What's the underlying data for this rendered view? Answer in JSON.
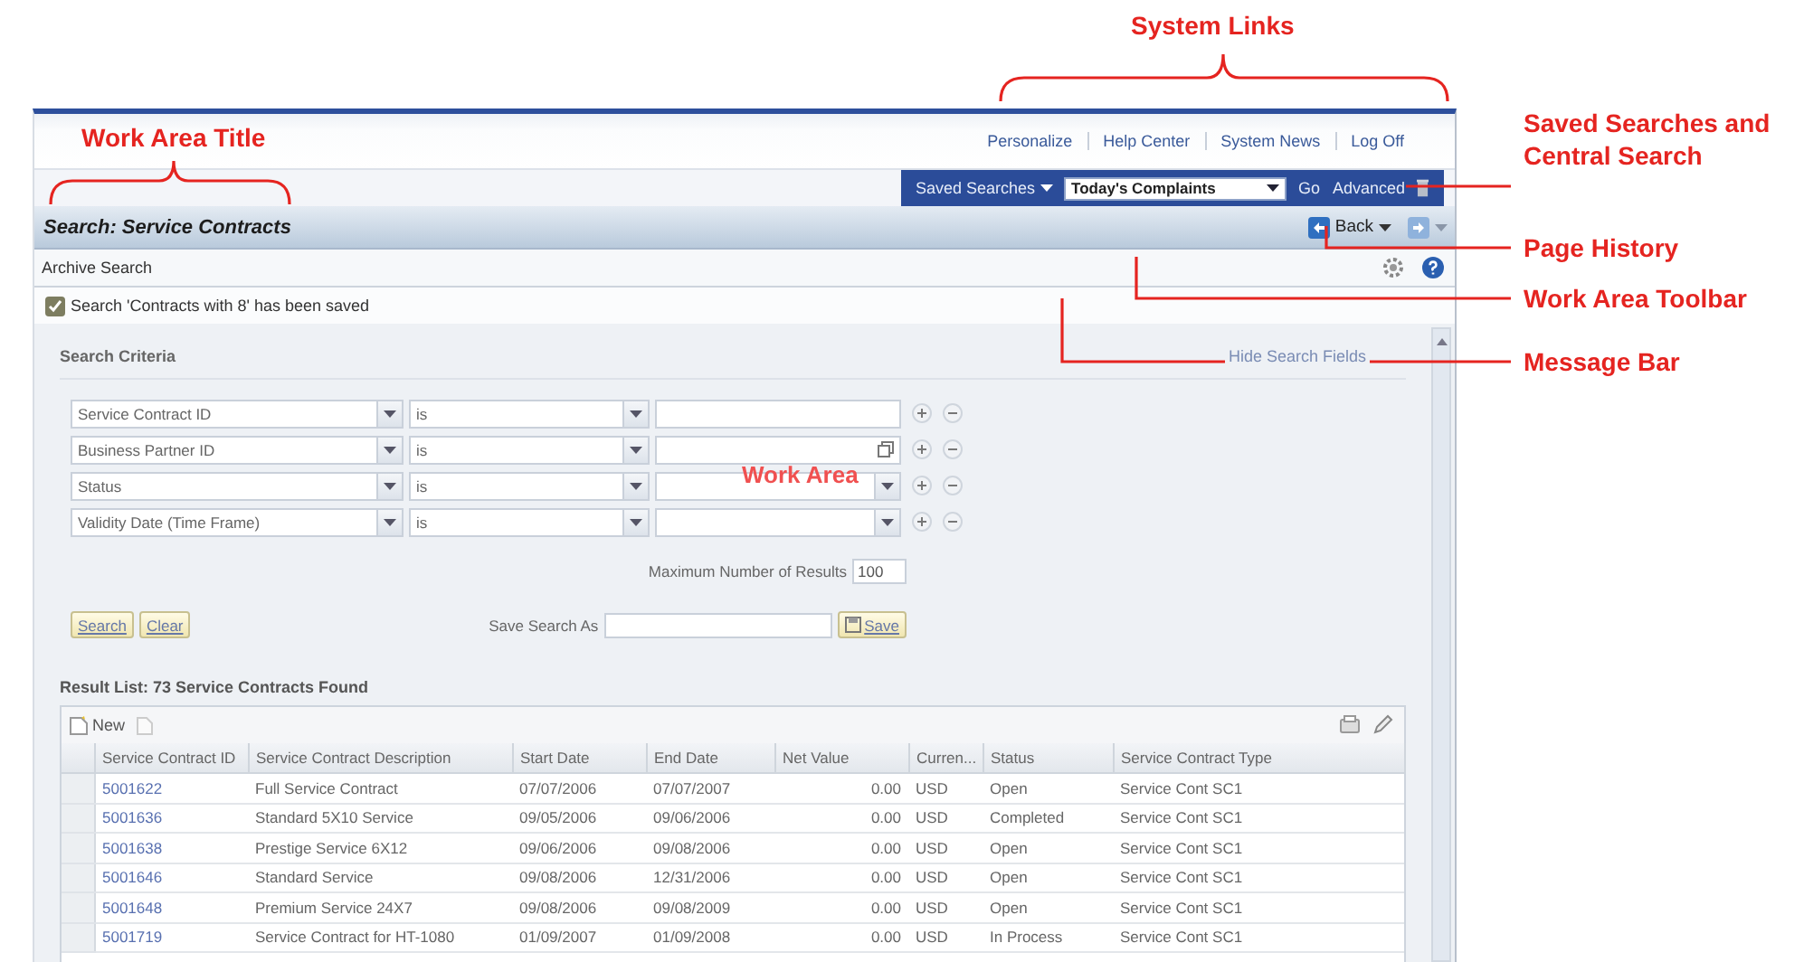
{
  "annotations": [
    {
      "label": "System Links",
      "kind": "brace"
    },
    {
      "label": "Work Area Title",
      "kind": "brace"
    },
    {
      "label": "Saved Searches and Central Search",
      "kind": "leader"
    },
    {
      "label": "Page History",
      "kind": "leader"
    },
    {
      "label": "Work Area Toolbar",
      "kind": "leader"
    },
    {
      "label": "Message Bar",
      "kind": "leader"
    },
    {
      "label": "Work Area",
      "kind": "overlay"
    }
  ],
  "system_links": [
    "Personalize",
    "Help Center",
    "System News",
    "Log Off"
  ],
  "central_search": {
    "saved_searches": "Saved Searches",
    "selection": "Today's Complaints",
    "go": "Go",
    "advanced": "Advanced"
  },
  "work_area": {
    "title": "Search: Service Contracts",
    "back": "Back"
  },
  "toolbar": {
    "buttons": [
      "Archive Search"
    ]
  },
  "message": {
    "text": "Search 'Contracts with 8' has been saved"
  },
  "search_criteria": {
    "title": "Search Criteria",
    "hide_link": "Hide Search Fields",
    "rows": [
      {
        "field": "Service Contract ID",
        "operator": "is",
        "kind": "text"
      },
      {
        "field": "Business Partner ID",
        "operator": "is",
        "kind": "lookup"
      },
      {
        "field": "Status",
        "operator": "is",
        "kind": "dropdown"
      },
      {
        "field": "Validity Date (Time Frame)",
        "operator": "is",
        "kind": "dropdown"
      }
    ],
    "max_results_label": "Maximum Number of Results",
    "max_results": "100",
    "search_button": "Search",
    "clear_button": "Clear",
    "save_as_label": "Save Search As",
    "save_button": "Save"
  },
  "result_list": {
    "title": "Result List: 73 Service Contracts Found",
    "new_button": "New",
    "columns": [
      "Service Contract ID",
      "Service Contract Description",
      "Start Date",
      "End Date",
      "Net Value",
      "Curren...",
      "Status",
      "Service Contract Type"
    ],
    "rows": [
      [
        "5001622",
        "Full Service Contract",
        "07/07/2006",
        "07/07/2007",
        "0.00",
        "USD",
        "Open",
        "Service Cont SC1"
      ],
      [
        "5001636",
        "Standard 5X10 Service",
        "09/05/2006",
        "09/06/2006",
        "0.00",
        "USD",
        "Completed",
        "Service Cont SC1"
      ],
      [
        "5001638",
        "Prestige Service 6X12",
        "09/06/2006",
        "09/08/2006",
        "0.00",
        "USD",
        "Open",
        "Service Cont SC1"
      ],
      [
        "5001646",
        "Standard Service",
        "09/08/2006",
        "12/31/2006",
        "0.00",
        "USD",
        "Open",
        "Service Cont SC1"
      ],
      [
        "5001648",
        "Premium Service 24X7",
        "09/08/2006",
        "09/08/2009",
        "0.00",
        "USD",
        "Open",
        "Service Cont SC1"
      ],
      [
        "5001719",
        "Service Contract for HT-1080",
        "01/09/2007",
        "01/09/2008",
        "0.00",
        "USD",
        "In Process",
        "Service Cont SC1"
      ]
    ]
  }
}
